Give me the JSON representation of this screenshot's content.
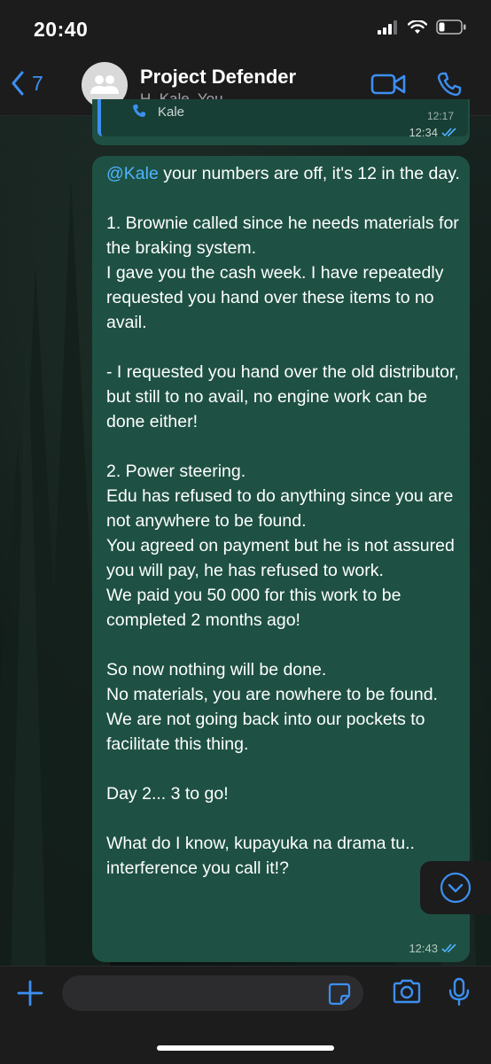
{
  "status_bar": {
    "time": "20:40"
  },
  "header": {
    "back_count": "7",
    "title": "Project Defender",
    "subtitle": "H, Kale, You"
  },
  "previous_message": {
    "quote_name": "Kale",
    "quote_time": "12:17",
    "time": "12:34"
  },
  "message": {
    "mention": "@Kale",
    "text": " your numbers are off, it's 12 in the day.\n\n1. Brownie called since he needs materials for the braking system.\nI gave you the cash week. I have repeatedly requested you hand over these items to no avail.\n\n- I requested you hand over the old distributor, but still to no avail, no engine work can be done either!\n\n2. Power steering.\nEdu has refused to do anything since you are not anywhere to be found.\nYou agreed on payment but he is not assured you will pay, he has refused to work.\nWe paid you 50 000 for this work to be completed 2 months ago!\n\nSo now nothing will be done.\nNo materials, you are nowhere to be found.\nWe are not going back into our pockets to facilitate this thing.\n\nDay 2... 3 to go!\n\nWhat do I know, kupayuka na drama tu.. interference you call it!?",
    "time": "12:43"
  },
  "composer": {
    "placeholder": ""
  },
  "colors": {
    "accent": "#3d8ff0",
    "bubble": "#1e5143",
    "mention": "#4fb3ff"
  }
}
